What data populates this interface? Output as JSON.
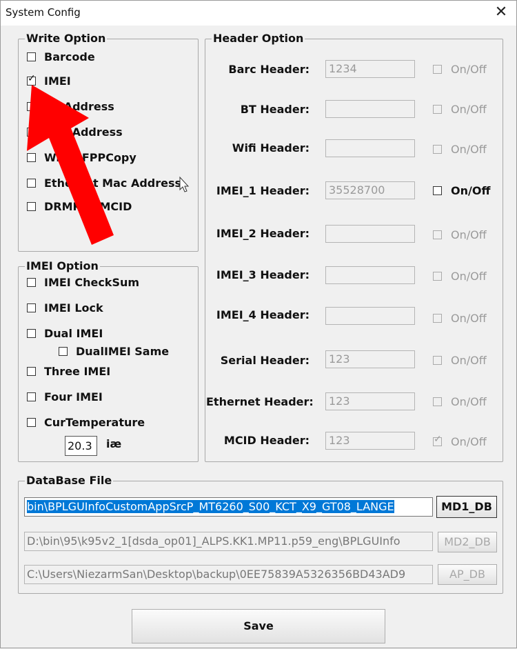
{
  "window": {
    "title": "System Config",
    "close_symbol": "✕"
  },
  "write_option": {
    "legend": "Write Option",
    "items": [
      {
        "label": "Barcode",
        "checked": false
      },
      {
        "label": "IMEI",
        "checked": true
      },
      {
        "label": "BT Address",
        "checked": false
      },
      {
        "label": "Wifi Address",
        "checked": false
      },
      {
        "label": "Write FPPCopy",
        "checked": false
      },
      {
        "label": "Ethernet Mac Address",
        "checked": false
      },
      {
        "label": "DRMKey MCID",
        "checked": false
      }
    ]
  },
  "imei_option": {
    "legend": "IMEI Option",
    "items": [
      {
        "label": "IMEI CheckSum",
        "checked": false
      },
      {
        "label": "IMEI Lock",
        "checked": false
      },
      {
        "label": "Dual IMEI",
        "checked": false
      },
      {
        "label": "DualIMEI Same",
        "checked": false
      },
      {
        "label": "Three IMEI",
        "checked": false
      },
      {
        "label": "Four IMEI",
        "checked": false
      },
      {
        "label": "CurTemperature",
        "checked": false
      }
    ],
    "temperature_value": "20.3",
    "temperature_unit": "iæ"
  },
  "header_option": {
    "legend": "Header Option",
    "rows": [
      {
        "label": "Barc Header:",
        "value": "1234",
        "onoff": "On/Off",
        "checked": false,
        "enabled": false
      },
      {
        "label": "BT Header:",
        "value": "",
        "onoff": "On/Off",
        "checked": false,
        "enabled": false
      },
      {
        "label": "Wifi Header:",
        "value": "",
        "onoff": "On/Off",
        "checked": false,
        "enabled": false
      },
      {
        "label": "IMEI_1 Header:",
        "value": "35528700",
        "onoff": "On/Off",
        "checked": false,
        "enabled": true
      },
      {
        "label": "IMEI_2 Header:",
        "value": "",
        "onoff": "On/Off",
        "checked": false,
        "enabled": false
      },
      {
        "label": "IMEI_3 Header:",
        "value": "",
        "onoff": "On/Off",
        "checked": false,
        "enabled": false
      },
      {
        "label": "IMEI_4 Header:",
        "value": "",
        "onoff": "On/Off",
        "checked": false,
        "enabled": false
      },
      {
        "label": "Serial Header:",
        "value": "123",
        "onoff": "On/Off",
        "checked": false,
        "enabled": false
      },
      {
        "label": "Ethernet Header:",
        "value": "123",
        "onoff": "On/Off",
        "checked": false,
        "enabled": false
      },
      {
        "label": "MCID Header:",
        "value": "123",
        "onoff": "On/Off",
        "checked": true,
        "enabled": false
      }
    ]
  },
  "database": {
    "legend": "DataBase File",
    "md1_path": "bin\\BPLGUInfoCustomAppSrcP_MT6260_S00_KCT_X9_GT08_LANGE",
    "md1_button": "MD1_DB",
    "md2_path": "D:\\bin\\95\\k95v2_1[dsda_op01]_ALPS.KK1.MP11.p59_eng\\BPLGUInfo",
    "md2_button": "MD2_DB",
    "ap_path": "C:\\Users\\NiezarmSan\\Desktop\\backup\\0EE75839A5326356BD43AD9",
    "ap_button": "AP_DB"
  },
  "save_button": "Save",
  "colors": {
    "selection": "#0078d7",
    "arrow": "#ff0000",
    "window_bg": "#f0f0f0"
  }
}
